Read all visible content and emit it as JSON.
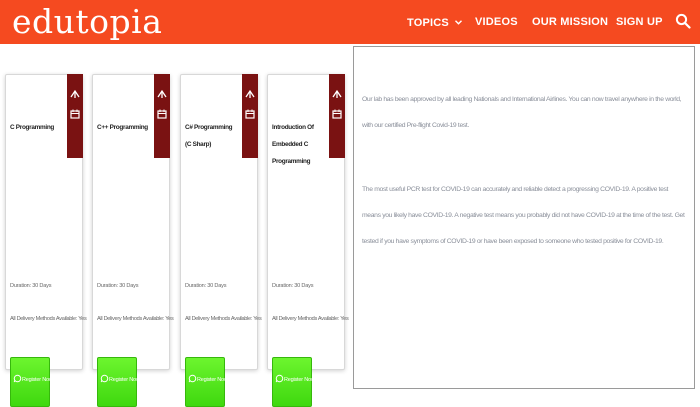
{
  "header": {
    "logo_text": "edutopia",
    "nav": [
      {
        "label": "TOPICS",
        "icon": "chevron-down-icon"
      },
      {
        "label": "VIDEOS"
      },
      {
        "label": "OUR MISSION"
      },
      {
        "label": "SIGN UP"
      }
    ],
    "search_icon": "search-icon",
    "bar_color": "#f54a20"
  },
  "cards": [
    {
      "title": "C Programming",
      "duration": "Duration: 30 Days",
      "delivery": "All Delivery Methods Available: Yes",
      "button_label": "Register Now"
    },
    {
      "title": "C++ Programming",
      "duration": "Duration: 30 Days",
      "delivery": "All Delivery Methods Available: Yes",
      "button_label": "Register Now"
    },
    {
      "title": "C# Programming (C Sharp)",
      "duration": "Duration: 30 Days",
      "delivery": "All Delivery Methods Available: Yes",
      "button_label": "Register Now"
    },
    {
      "title": "Introduction Of Embedded C Programming",
      "duration": "Duration: 30 Days",
      "delivery": "All Delivery Methods Available: Yes",
      "button_label": "Register Now"
    }
  ],
  "card_tab_color": "#7a1212",
  "card_tab_icons": [
    "share-icon",
    "calendar-icon"
  ],
  "button_icon": "whatsapp-icon",
  "button_color": "#4fe61a",
  "panel": {
    "paragraph1": "Our lab has been approved by all leading Nationals and International Airlines. You can now travel anywhere in the world, with our certified Pre-flight Covid-19 test.",
    "paragraph2": "The most useful PCR test for COVID-19 can accurately and reliable detect a progressing COVID-19. A positive test means you likely have COVID-19. A negative test means you probably did not have COVID-19 at the time of the test. Get tested if you have symptoms of COVID-19 or have been exposed to someone who tested positive for COVID-19."
  }
}
